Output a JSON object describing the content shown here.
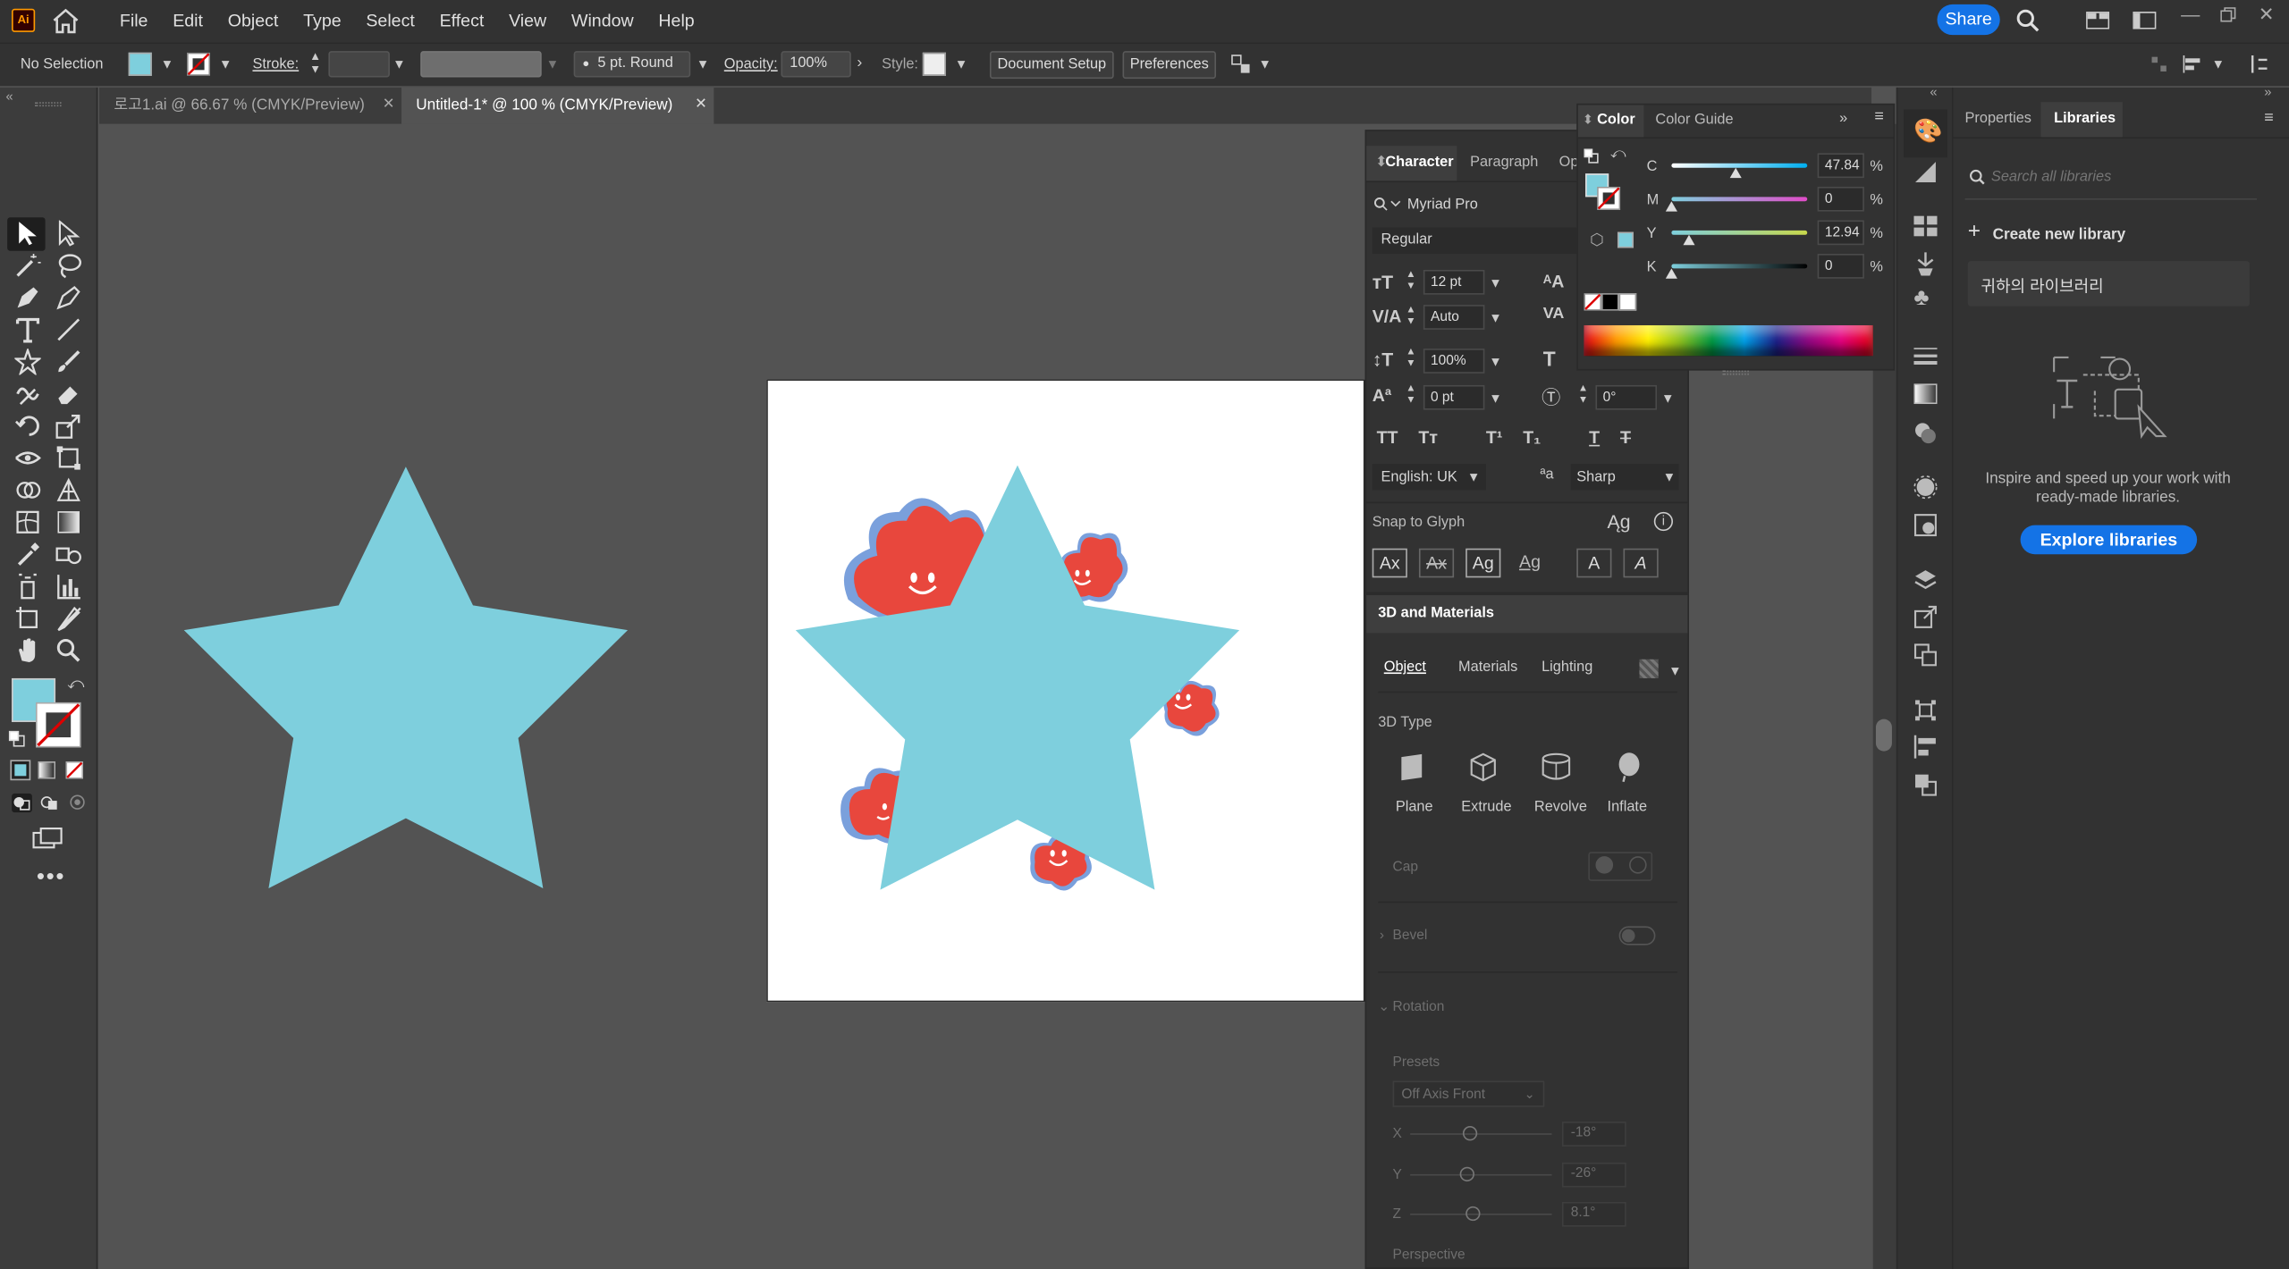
{
  "app": {
    "logo": "Ai"
  },
  "menubar": {
    "items": [
      "File",
      "Edit",
      "Object",
      "Type",
      "Select",
      "Effect",
      "View",
      "Window",
      "Help"
    ],
    "share": "Share"
  },
  "control": {
    "selection": "No Selection",
    "stroke_label": "Stroke:",
    "brush": "5 pt. Round",
    "opacity_label": "Opacity:",
    "opacity": "100%",
    "style_label": "Style:",
    "doc_setup": "Document Setup",
    "preferences": "Preferences"
  },
  "tabs": [
    {
      "label": "로고1.ai @ 66.67 % (CMYK/Preview)",
      "active": false
    },
    {
      "label": "Untitled-1* @ 100 % (CMYK/Preview)",
      "active": true
    }
  ],
  "colors": {
    "fill": "#7ecfdd",
    "accent": "#1473e6",
    "flower": "#e8473d",
    "flower_shadow": "#7aa0dc"
  },
  "color_panel": {
    "tabs": [
      "Color",
      "Color Guide"
    ],
    "channels": [
      {
        "name": "C",
        "value": "47.84",
        "unit": "%",
        "level": 0.4784
      },
      {
        "name": "M",
        "value": "0",
        "unit": "%",
        "level": 0
      },
      {
        "name": "Y",
        "value": "12.94",
        "unit": "%",
        "level": 0.1294
      },
      {
        "name": "K",
        "value": "0",
        "unit": "%",
        "level": 0
      }
    ]
  },
  "character": {
    "tabs": [
      "Character",
      "Paragraph",
      "Op"
    ],
    "font": "Myriad Pro",
    "style": "Regular",
    "size": "12 pt",
    "kerning": "Auto",
    "leading_scale": "100%",
    "tracking": "0 pt",
    "rotation": "0°",
    "language": "English: UK",
    "antialias": "Sharp",
    "snap": "Snap to Glyph",
    "aa": "a"
  },
  "materials": {
    "title": "3D and Materials",
    "tabs": [
      "Object",
      "Materials",
      "Lighting"
    ],
    "type_label": "3D Type",
    "types": [
      "Plane",
      "Extrude",
      "Revolve",
      "Inflate"
    ],
    "cap": "Cap",
    "bevel": "Bevel",
    "rotation": "Rotation",
    "presets": "Presets",
    "preset_value": "Off Axis Front",
    "x_label": "X",
    "x": "-18°",
    "y_label": "Y",
    "y": "-26°",
    "z_label": "Z",
    "z": "8.1°",
    "perspective": "Perspective"
  },
  "libraries": {
    "tabs": [
      "Properties",
      "Libraries"
    ],
    "search_placeholder": "Search all libraries",
    "create": "Create new library",
    "library_item": "귀하의 라이브러리",
    "info": "Inspire and speed up your work with ready-made libraries.",
    "explore": "Explore libraries"
  }
}
